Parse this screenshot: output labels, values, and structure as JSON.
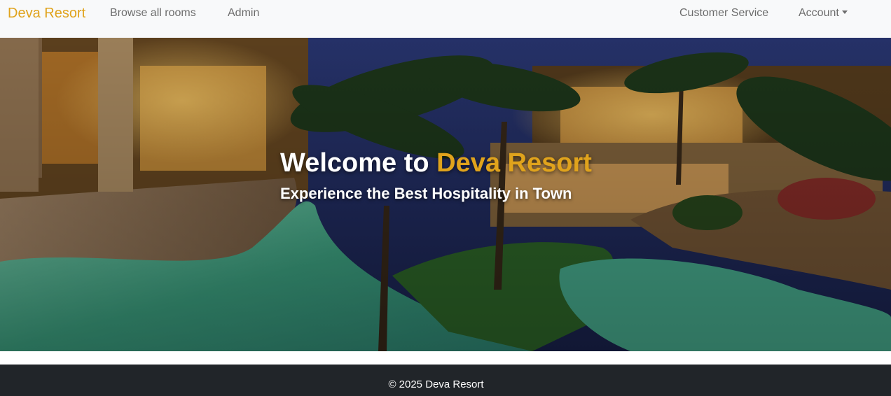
{
  "navbar": {
    "brand": "Deva Resort",
    "links": {
      "browse": "Browse all rooms",
      "admin": "Admin",
      "customer_service": "Customer Service",
      "account": "Account"
    }
  },
  "hero": {
    "title_prefix": "Welcome to ",
    "title_accent": "Deva Resort",
    "subtitle": "Experience the Best Hospitality in Town",
    "image": "resort-pool-night-photo"
  },
  "footer": {
    "text": "© 2025 Deva Resort"
  },
  "colors": {
    "accent": "#e0a31c",
    "navbar_bg": "#f8f9fa",
    "footer_bg": "#212529"
  }
}
